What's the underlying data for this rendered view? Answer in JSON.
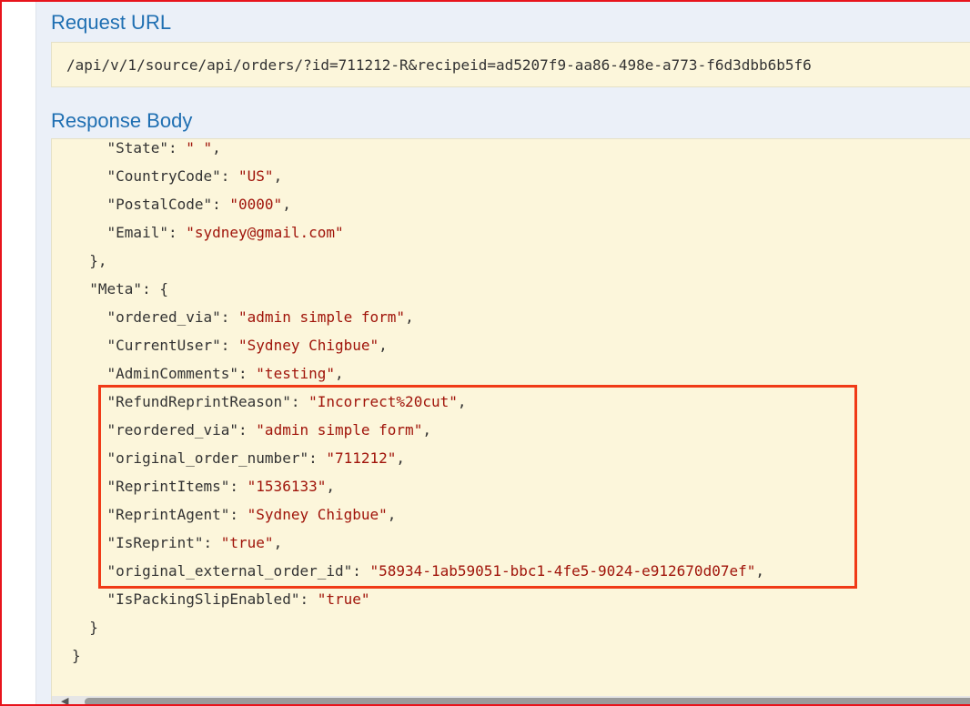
{
  "request_url": {
    "title": "Request URL",
    "value": "/api/v/1/source/api/orders/?id=711212-R&recipeid=ad5207f9-aa86-498e-a773-f6d3dbb6b5f6"
  },
  "response_body": {
    "title": "Response Body",
    "lines": [
      {
        "indent": "    ",
        "key": "\"State\"",
        "sep": ": ",
        "value": "\" \"",
        "end": ","
      },
      {
        "indent": "    ",
        "key": "\"CountryCode\"",
        "sep": ": ",
        "value": "\"US\"",
        "end": ","
      },
      {
        "indent": "    ",
        "key": "\"PostalCode\"",
        "sep": ": ",
        "value": "\"0000\"",
        "end": ","
      },
      {
        "indent": "    ",
        "key": "\"Email\"",
        "sep": ": ",
        "value": "\"sydney@gmail.com\"",
        "end": ""
      },
      {
        "indent": "  ",
        "key": "},",
        "sep": "",
        "value": "",
        "end": ""
      },
      {
        "indent": "  ",
        "key": "\"Meta\"",
        "sep": ": {",
        "value": "",
        "end": ""
      },
      {
        "indent": "    ",
        "key": "\"ordered_via\"",
        "sep": ": ",
        "value": "\"admin simple form\"",
        "end": ","
      },
      {
        "indent": "    ",
        "key": "\"CurrentUser\"",
        "sep": ": ",
        "value": "\"Sydney Chigbue\"",
        "end": ","
      },
      {
        "indent": "    ",
        "key": "\"AdminComments\"",
        "sep": ": ",
        "value": "\"testing\"",
        "end": ","
      },
      {
        "indent": "    ",
        "key": "\"RefundReprintReason\"",
        "sep": ": ",
        "value": "\"Incorrect%20cut\"",
        "end": ","
      },
      {
        "indent": "    ",
        "key": "\"reordered_via\"",
        "sep": ": ",
        "value": "\"admin simple form\"",
        "end": ","
      },
      {
        "indent": "    ",
        "key": "\"original_order_number\"",
        "sep": ": ",
        "value": "\"711212\"",
        "end": ","
      },
      {
        "indent": "    ",
        "key": "\"ReprintItems\"",
        "sep": ": ",
        "value": "\"1536133\"",
        "end": ","
      },
      {
        "indent": "    ",
        "key": "\"ReprintAgent\"",
        "sep": ": ",
        "value": "\"Sydney Chigbue\"",
        "end": ","
      },
      {
        "indent": "    ",
        "key": "\"IsReprint\"",
        "sep": ": ",
        "value": "\"true\"",
        "end": ","
      },
      {
        "indent": "    ",
        "key": "\"original_external_order_id\"",
        "sep": ": ",
        "value": "\"58934-1ab59051-bbc1-4fe5-9024-e912670d07ef\"",
        "end": ","
      },
      {
        "indent": "    ",
        "key": "\"IsPackingSlipEnabled\"",
        "sep": ": ",
        "value": "\"true\"",
        "end": ""
      },
      {
        "indent": "  ",
        "key": "}",
        "sep": "",
        "value": "",
        "end": ""
      },
      {
        "indent": "",
        "key": "}",
        "sep": "",
        "value": "",
        "end": ""
      }
    ]
  },
  "icons": {
    "scroll_left": "scroll-left-arrow-icon"
  },
  "colors": {
    "frame_border": "#e8141c",
    "highlight_border": "#f03a17",
    "title": "#1f6fb2",
    "string_value": "#a0140a",
    "code_background": "#fcf6db"
  }
}
